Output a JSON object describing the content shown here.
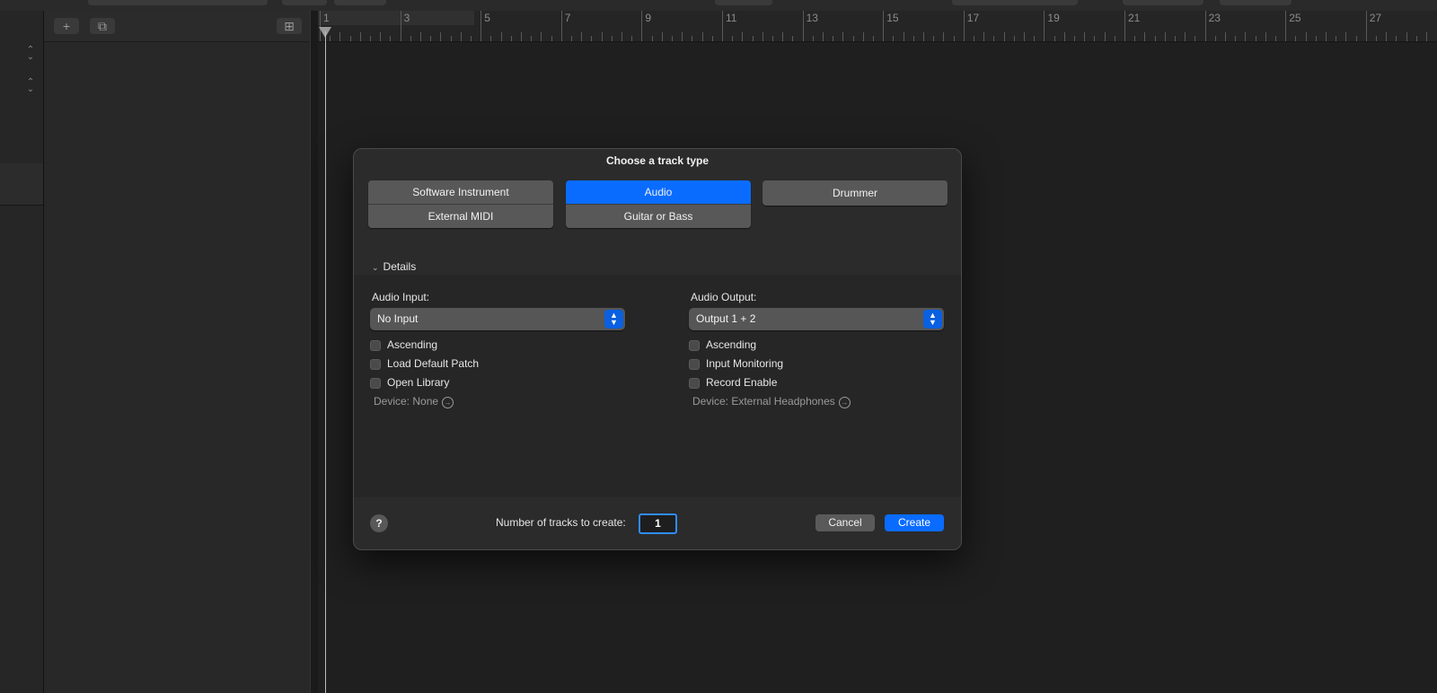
{
  "ruler": {
    "bars": [
      "1",
      "3",
      "5",
      "7",
      "9",
      "11",
      "13",
      "15",
      "17",
      "19",
      "21",
      "23",
      "25",
      "27"
    ]
  },
  "header_toolbar": {
    "add_icon": "+",
    "duplicate_icon": "⧉",
    "folder_icon": "⊞"
  },
  "dialog": {
    "title": "Choose a track type",
    "track_types": {
      "software_instrument": "Software Instrument",
      "external_midi": "External MIDI",
      "audio": "Audio",
      "guitar_or_bass": "Guitar or Bass",
      "drummer": "Drummer",
      "selected": "Audio"
    },
    "details_label": "Details",
    "input": {
      "label": "Audio Input:",
      "value": "No Input",
      "options": [
        "Ascending",
        "Load Default Patch",
        "Open Library"
      ],
      "device": "Device: None"
    },
    "output": {
      "label": "Audio Output:",
      "value": "Output 1 + 2",
      "options": [
        "Ascending",
        "Input Monitoring",
        "Record Enable"
      ],
      "device": "Device: External Headphones"
    },
    "help": "?",
    "count_label": "Number of tracks to create:",
    "count_value": "1",
    "cancel": "Cancel",
    "create": "Create"
  },
  "colors": {
    "accent": "#0a6cff",
    "background": "#1f1f1f",
    "dialog": "#2b2b2b"
  }
}
